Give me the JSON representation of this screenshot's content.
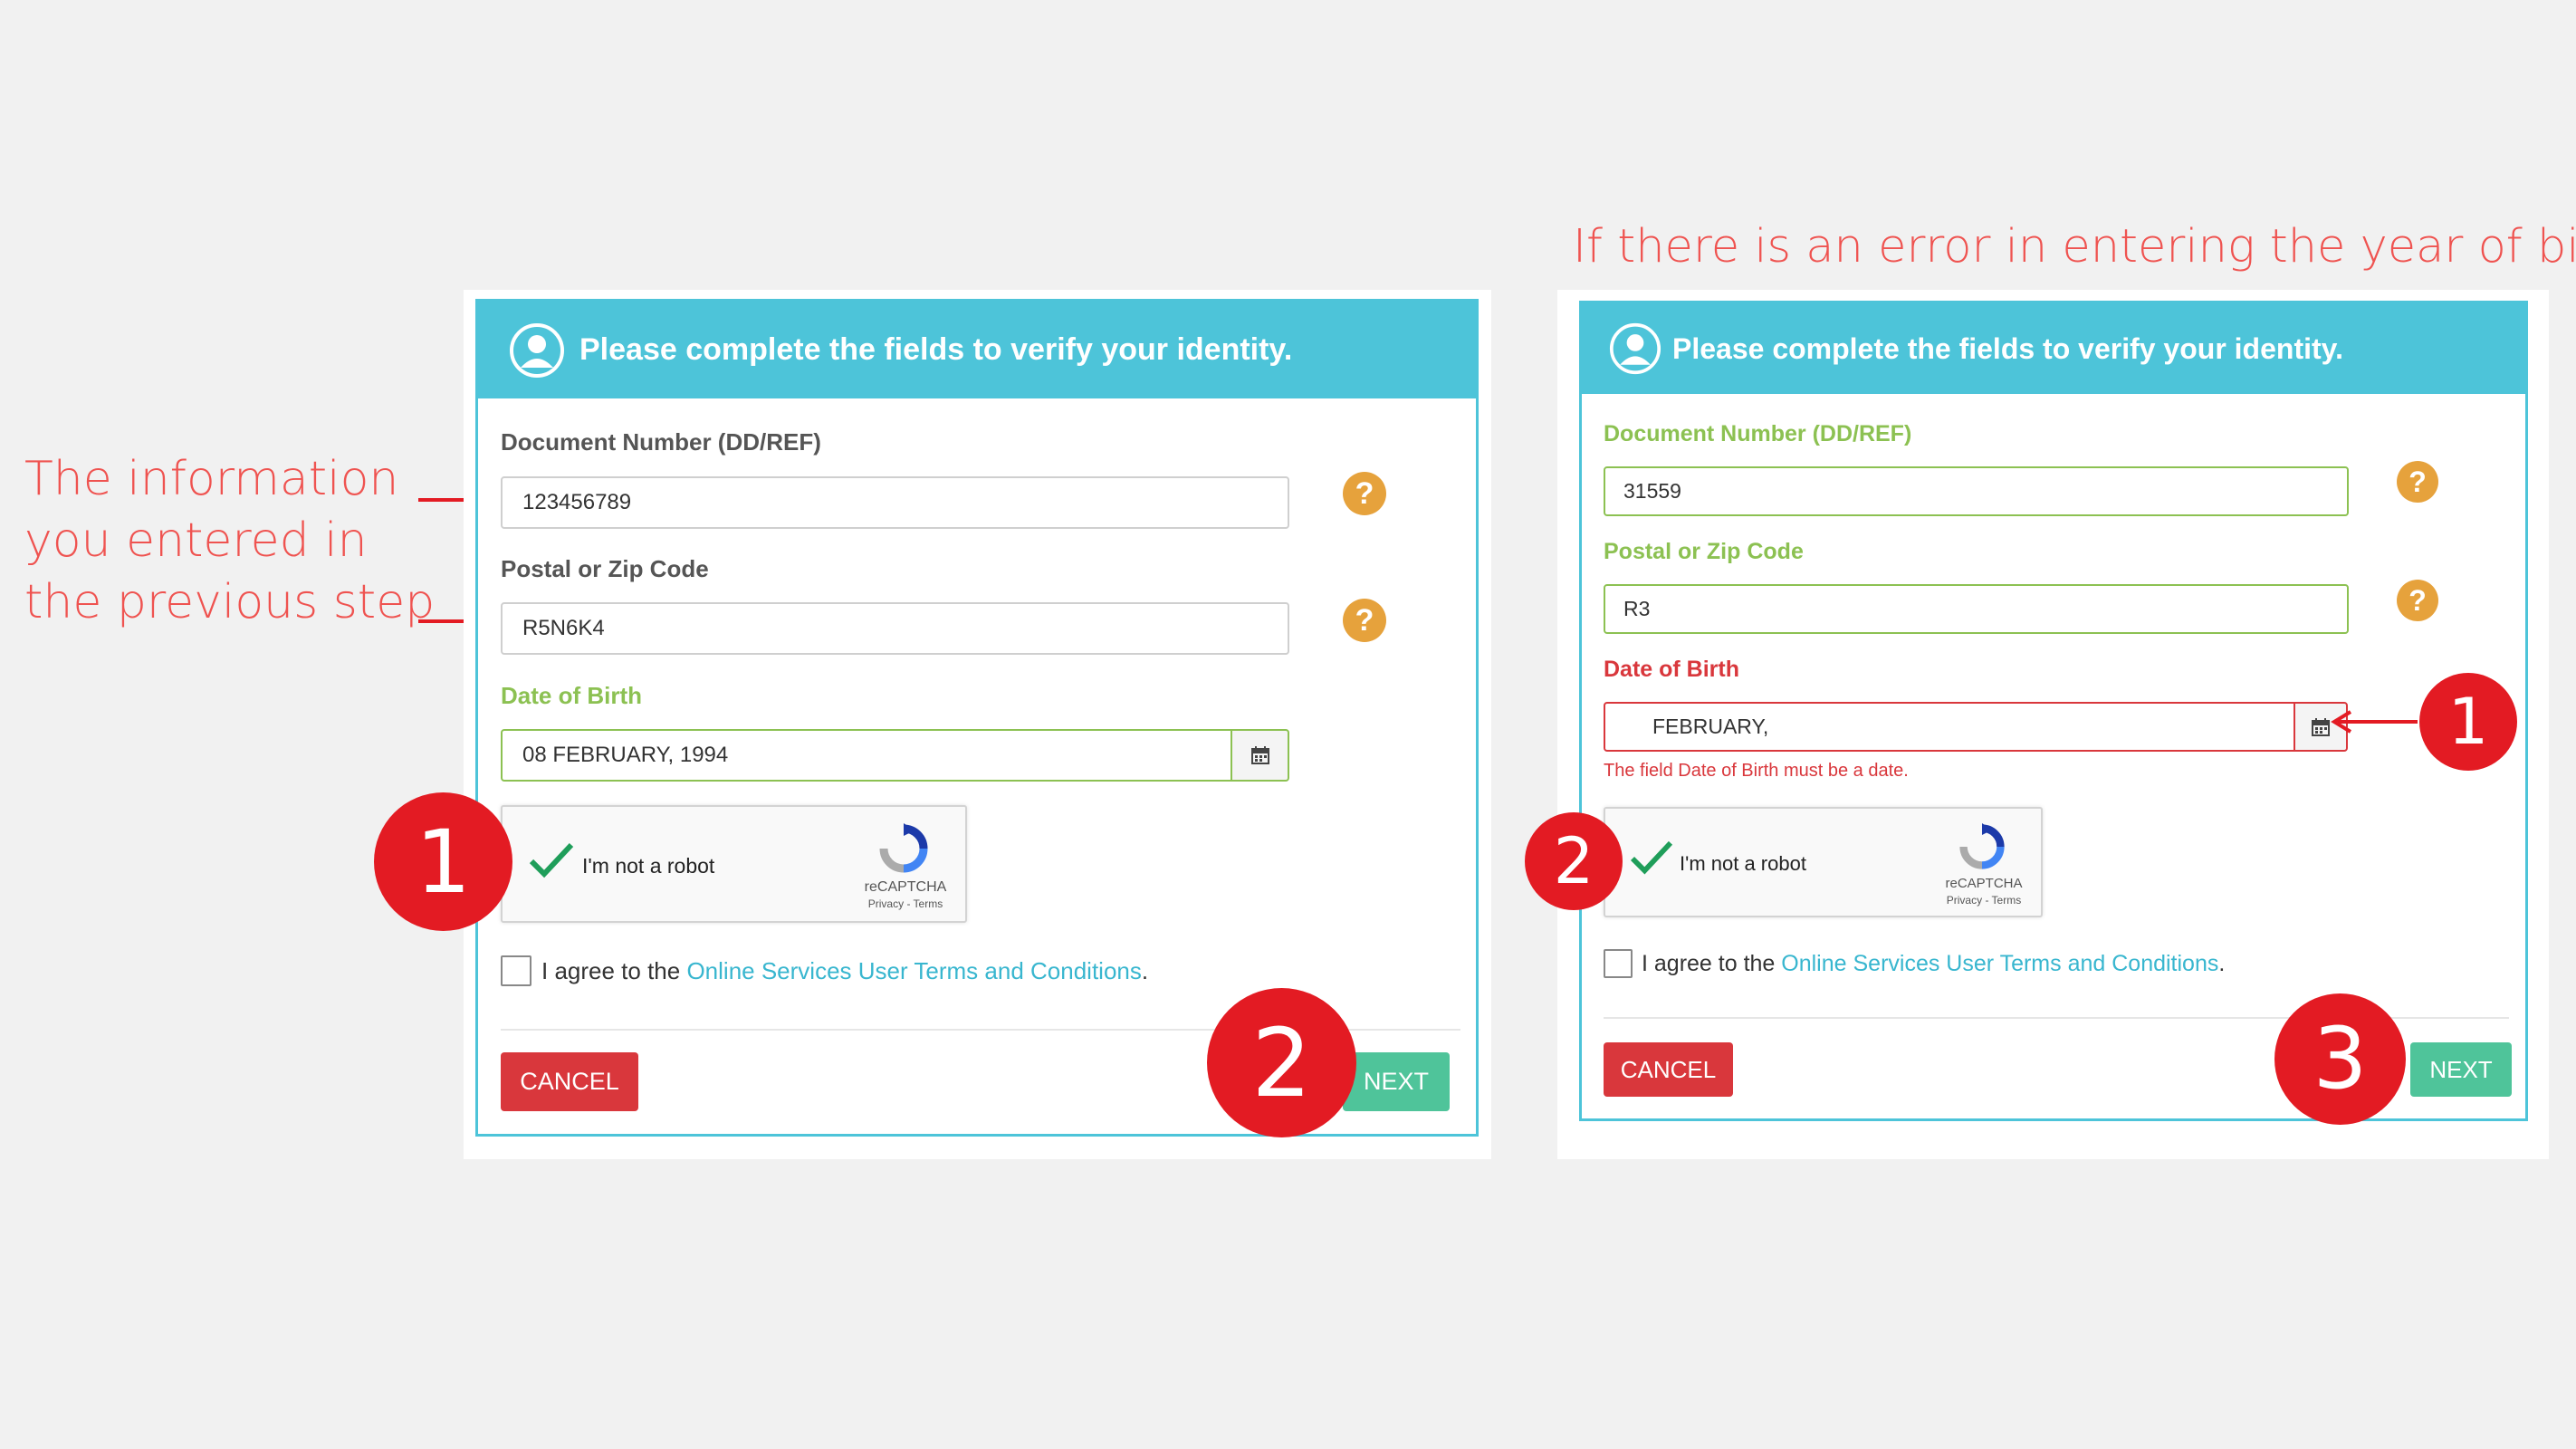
{
  "annotations": {
    "left_note_lines": [
      "The information",
      "you entered in",
      "the previous step"
    ],
    "right_note": "If there is an error in entering the year of birth"
  },
  "colors": {
    "header": "#4dc4d9",
    "annotation": "#ef5350",
    "badge": "#e31b23",
    "cancel": "#d9373c",
    "next": "#4fc49a",
    "valid": "#8cc152",
    "error": "#d9373c",
    "help": "#e6a23c",
    "link": "#38b6cf"
  },
  "left_form": {
    "header_title": "Please complete the fields to verify your identity.",
    "document_label": "Document Number (DD/REF)",
    "document_value": "123456789",
    "postal_label": "Postal or Zip Code",
    "postal_value": "R5N6K4",
    "dob_label": "Date of Birth",
    "dob_value": "08 FEBRUARY, 1994",
    "help_glyph": "?",
    "captcha_text": "I'm not a robot",
    "captcha_brand": "reCAPTCHA",
    "captcha_links": "Privacy - Terms",
    "agree_prefix": "I agree to the ",
    "agree_link": "Online Services User Terms and Conditions",
    "agree_suffix": ".",
    "cancel_label": "CANCEL",
    "next_label": "NEXT",
    "badge_captcha": "1",
    "badge_next": "2"
  },
  "right_form": {
    "header_title": "Please complete the fields to verify your identity.",
    "document_label": "Document Number (DD/REF)",
    "document_value": "31559",
    "postal_label": "Postal or Zip Code",
    "postal_value": "R3",
    "dob_label": "Date of Birth",
    "dob_value": "FEBRUARY,",
    "dob_error": "The field Date of Birth must be a date.",
    "help_glyph": "?",
    "captcha_text": "I'm not a robot",
    "captcha_brand": "reCAPTCHA",
    "captcha_links": "Privacy - Terms",
    "agree_prefix": "I agree to the ",
    "agree_link": "Online Services User Terms and Conditions",
    "agree_suffix": ".",
    "cancel_label": "CANCEL",
    "next_label": "NEXT",
    "badge_dob": "1",
    "badge_captcha": "2",
    "badge_next": "3"
  }
}
